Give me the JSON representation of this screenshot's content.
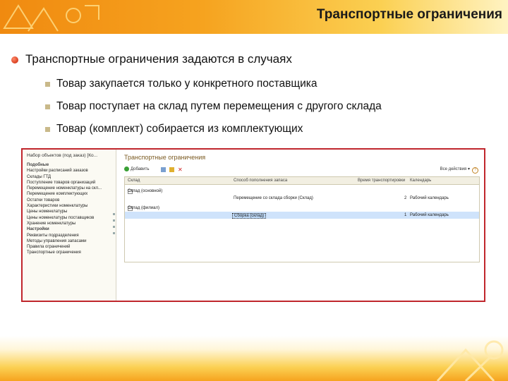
{
  "slide": {
    "title": "Транспортные ограничения",
    "main_point": "Транспортные ограничения задаются в случаях",
    "sub_points": [
      "Товар закупается только у конкретного поставщика",
      "Товар поступает на склад путем перемещения с другого склада",
      "Товар (комплект) собирается из комплектующих"
    ]
  },
  "screenshot": {
    "left_title": "Набор объектов (под заказ) [Ко...",
    "left_items": [
      {
        "text": "Подобные",
        "header": true
      },
      {
        "text": "Настройки расписаний заказов",
        "header": false
      },
      {
        "text": "Склады ГТД",
        "header": false
      },
      {
        "text": "Поступление товаров организаций",
        "header": false
      },
      {
        "text": "Перемещение номенклатуры на скл...",
        "header": false
      },
      {
        "text": "Перемещение комплектующих",
        "header": false
      },
      {
        "text": "Остатки товаров",
        "header": false
      },
      {
        "text": "Характеристики номенклатуры",
        "header": false
      },
      {
        "text": "Цены номенклатуры",
        "header": false
      },
      {
        "text": "Цены номенклатуры поставщиков",
        "header": false
      },
      {
        "text": "Хранение номенклатуры",
        "header": false
      },
      {
        "text": "Настройки",
        "header": true
      },
      {
        "text": "Реквизиты подразделения",
        "header": false
      },
      {
        "text": "Методы управления запасами",
        "header": false
      },
      {
        "text": "Правила ограничений",
        "header": false
      },
      {
        "text": "Транспортные ограничения",
        "header": false
      }
    ],
    "form_title": "Транспортные ограничения",
    "toolbar": {
      "add": "Добавить",
      "actions": "Все действия"
    },
    "columns": [
      "Склад",
      "Способ пополнения запаса",
      "Время транспортировки",
      "Календарь"
    ],
    "rows": [
      {
        "warehouse": "Склад (основной)",
        "method": "",
        "time": "",
        "calendar": ""
      },
      {
        "warehouse": "",
        "method": "Перемещение со склада сборки (Склад)",
        "time": "2",
        "calendar": "Рабочий календарь"
      },
      {
        "warehouse": "Склад (филиал)",
        "method": "",
        "time": "",
        "calendar": ""
      },
      {
        "warehouse": "",
        "method": "Сборка (склад)",
        "time": "1",
        "calendar": "Рабочий календарь"
      }
    ]
  },
  "colors": {
    "accent": "#f6a31f",
    "bullet": "#c81e00",
    "frame": "#c0262c",
    "selection": "#cfe3fb"
  }
}
